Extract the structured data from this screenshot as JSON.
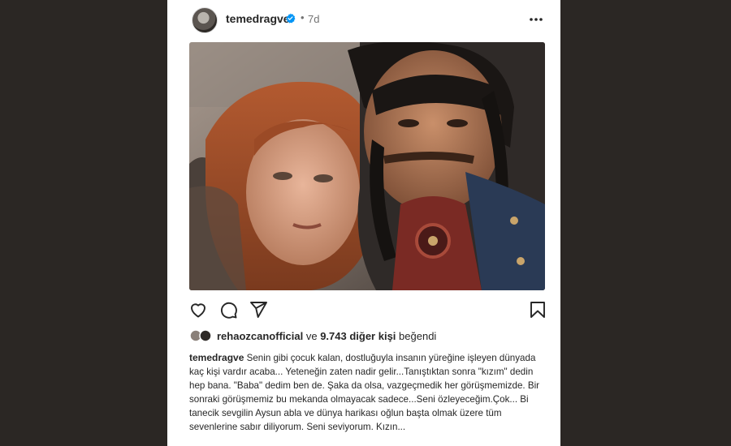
{
  "post": {
    "username": "temedragve",
    "separator": "•",
    "time": "7d"
  },
  "likes": {
    "liker": "rehaozcanofficial",
    "connector": "ve",
    "others": "9.743 diğer kişi",
    "suffix": "beğendi"
  },
  "caption": {
    "author": "temedragve",
    "text": "Senin gibi çocuk kalan, dostluğuyla insanın yüreğine işleyen dünyada kaç kişi vardır acaba... Yeteneğin zaten nadir gelir...Tanıştıktan sonra \"kızım\" dedin hep bana. \"Baba\" dedim ben de. Şaka da olsa, vazgeçmedik her görüşmemizde. Bir sonraki görüşmemiz bu mekanda olmayacak sadece...Seni özleyeceğim.Çok... Bi tanecik sevgilin Aysun abla ve dünya harikası oğlun başta olmak üzere tüm sevenlerine sabır diliyorum. Seni seviyorum. Kızın..."
  },
  "icons": {
    "verified": "verified-badge-icon",
    "more": "more-options-icon",
    "like": "heart-icon",
    "comment": "comment-icon",
    "share": "share-icon",
    "save": "bookmark-icon"
  },
  "colors": {
    "background": "#2b2724",
    "card": "#ffffff",
    "verified": "#0095f6",
    "muted": "#737373",
    "text": "#262626"
  }
}
